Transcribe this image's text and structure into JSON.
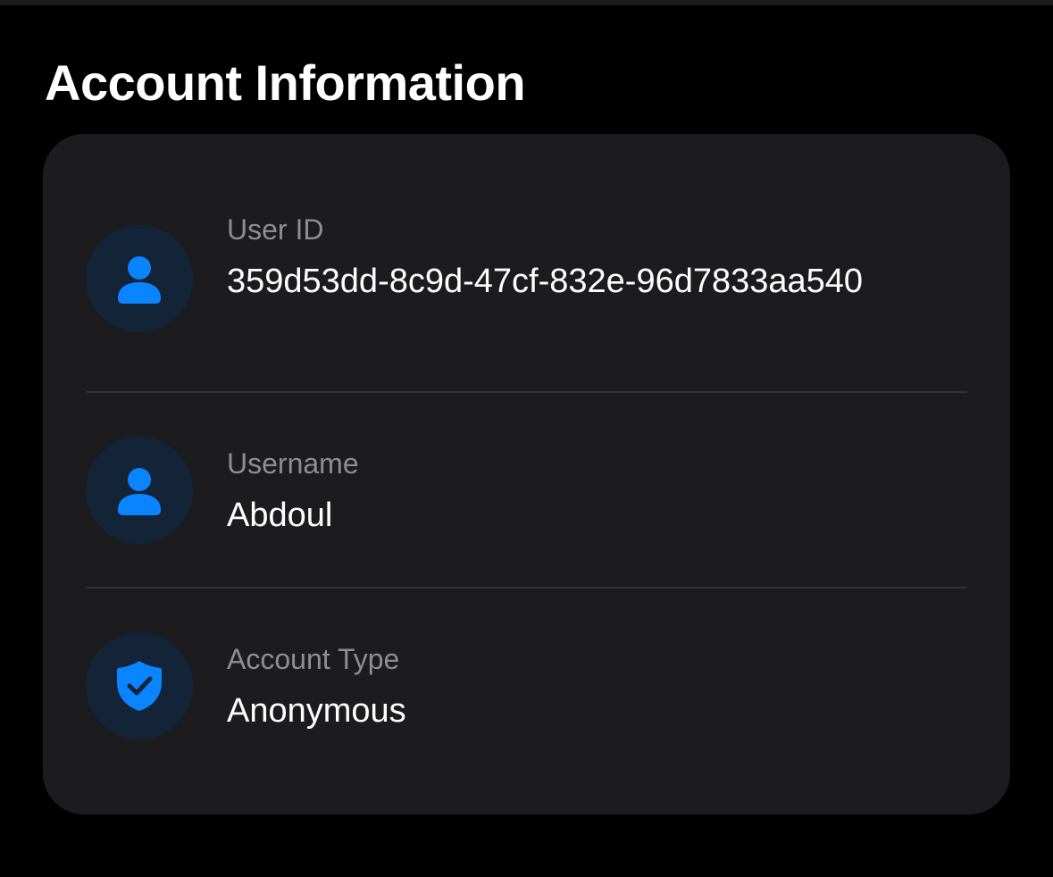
{
  "section": {
    "title": "Account Information"
  },
  "fields": [
    {
      "label": "User ID",
      "value": "359d53dd-8c9d-47cf-832e-96d7833aa540",
      "icon": "person-icon"
    },
    {
      "label": "Username",
      "value": "Abdoul",
      "icon": "person-icon"
    },
    {
      "label": "Account Type",
      "value": "Anonymous",
      "icon": "shield-check-icon"
    }
  ],
  "colors": {
    "background": "#000000",
    "card": "#1c1c1e",
    "icon_accent": "#0a84ff",
    "icon_circle": "#132338",
    "label": "#8d8d93",
    "value": "#ffffff",
    "divider": "#333336"
  }
}
